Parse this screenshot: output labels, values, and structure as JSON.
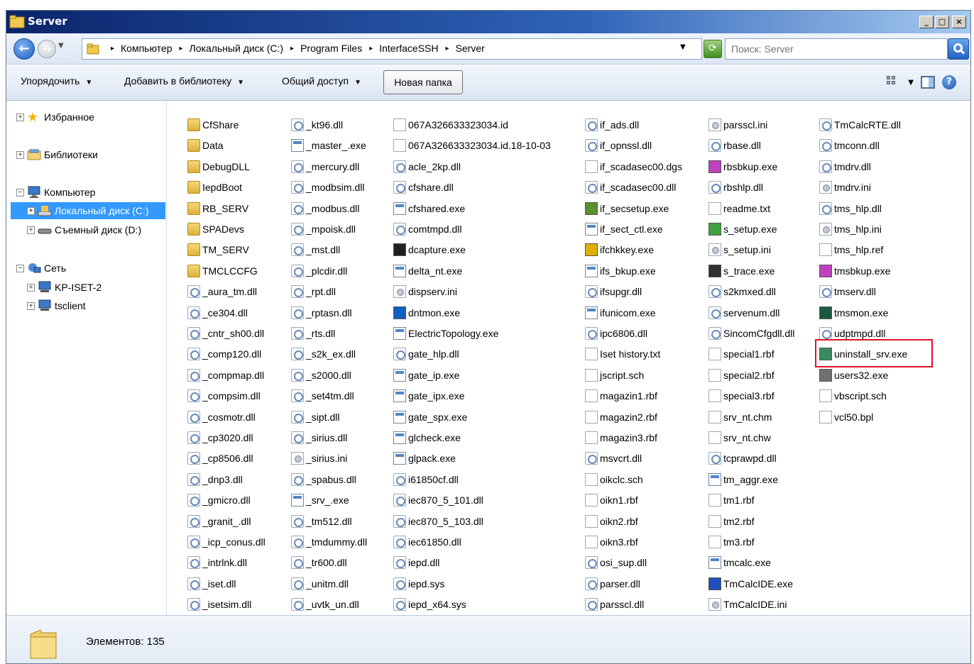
{
  "window": {
    "title": "Server"
  },
  "titlebar": {
    "minimize": "_",
    "maximize": "□",
    "close": "×"
  },
  "address": {
    "crumbs": [
      "Компьютер",
      "Локальный диск (C:)",
      "Program Files",
      "InterfaceSSH",
      "Server"
    ]
  },
  "search": {
    "placeholder": "Поиск: Server"
  },
  "toolbar": {
    "organize": "Упорядочить",
    "add_library": "Добавить в библиотеку",
    "share": "Общий доступ",
    "new_folder": "Новая папка"
  },
  "navpane": {
    "favorites": "Избранное",
    "libraries": "Библиотеки",
    "computer": "Компьютер",
    "local_disk": "Локальный диск (C:)",
    "removable_disk": "Съемный диск (D:)",
    "network": "Сеть",
    "kp_iset": "KP-ISET-2",
    "tsclient": "tsclient"
  },
  "files": [
    [
      "CfShare",
      "Data",
      "DebugDLL",
      "IepdBoot",
      "RB_SERV",
      "SPADevs",
      "TM_SERV",
      "TMCLCCFG",
      "_aura_tm.dll",
      "_ce304.dll",
      "_cntr_sh00.dll",
      "_comp120.dll",
      "_compmap.dll",
      "_compsim.dll",
      "_cosmotr.dll",
      "_cp3020.dll",
      "_cp8506.dll",
      "_dnp3.dll",
      "_gmicro.dll",
      "_granit_.dll",
      "_icp_conus.dll",
      "_intrlnk.dll",
      "_iset.dll",
      "_isetsim.dll"
    ],
    [
      "_kt96.dll",
      "_master_.exe",
      "_mercury.dll",
      "_modbsim.dll",
      "_modbus.dll",
      "_mpoisk.dll",
      "_mst.dll",
      "_plcdir.dll",
      "_rpt.dll",
      "_rptasn.dll",
      "_rts.dll",
      "_s2k_ex.dll",
      "_s2000.dll",
      "_set4tm.dll",
      "_sipt.dll",
      "_sirius.dll",
      "_sirius.ini",
      "_spabus.dll",
      "_srv_.exe",
      "_tm512.dll",
      "_tmdummy.dll",
      "_tr600.dll",
      "_unitm.dll",
      "_uvtk_un.dll"
    ],
    [
      "067A326633323034.id",
      "067A326633323034.id.18-10-03",
      "acle_2kp.dll",
      "cfshare.dll",
      "cfshared.exe",
      "comtmpd.dll",
      "dcapture.exe",
      "delta_nt.exe",
      "dispserv.ini",
      "dntmon.exe",
      "ElectricTopology.exe",
      "gate_hlp.dll",
      "gate_ip.exe",
      "gate_ipx.exe",
      "gate_spx.exe",
      "glcheck.exe",
      "glpack.exe",
      "i61850cf.dll",
      "iec870_5_101.dll",
      "iec870_5_103.dll",
      "iec61850.dll",
      "iepd.dll",
      "iepd.sys",
      "iepd_x64.sys"
    ],
    [
      "if_ads.dll",
      "if_opnssl.dll",
      "if_scadasec00.dgs",
      "if_scadasec00.dll",
      "if_secsetup.exe",
      "if_sect_ctl.exe",
      "ifchkkey.exe",
      "ifs_bkup.exe",
      "ifsupgr.dll",
      "ifunicom.exe",
      "ipc6806.dll",
      "Iset history.txt",
      "jscript.sch",
      "magazin1.rbf",
      "magazin2.rbf",
      "magazin3.rbf",
      "msvcrt.dll",
      "oikclc.sch",
      "oikn1.rbf",
      "oikn2.rbf",
      "oikn3.rbf",
      "osi_sup.dll",
      "parser.dll",
      "parsscl.dll"
    ],
    [
      "parsscl.ini",
      "rbase.dll",
      "rbsbkup.exe",
      "rbshlp.dll",
      "readme.txt",
      "s_setup.exe",
      "s_setup.ini",
      "s_trace.exe",
      "s2kmxed.dll",
      "servenum.dll",
      "SincomCfgdll.dll",
      "special1.rbf",
      "special2.rbf",
      "special3.rbf",
      "srv_nt.chm",
      "srv_nt.chw",
      "tcprawpd.dll",
      "tm_aggr.exe",
      "tm1.rbf",
      "tm2.rbf",
      "tm3.rbf",
      "tmcalc.exe",
      "TmCalcIDE.exe",
      "TmCalcIDE.ini"
    ],
    [
      "TmCalcRTE.dll",
      "tmconn.dll",
      "tmdrv.dll",
      "tmdrv.ini",
      "tms_hlp.dll",
      "tms_hlp.ini",
      "tms_hlp.ref",
      "tmsbkup.exe",
      "tmserv.dll",
      "tmsmon.exe",
      "udptmpd.dll",
      "uninstall_srv.exe",
      "users32.exe",
      "vbscript.sch",
      "vcl50.bpl"
    ]
  ],
  "highlighted_file": "uninstall_srv.exe",
  "status": {
    "count": "Элементов: 135"
  },
  "colors": {
    "selection": "#3399ff",
    "highlight": "#e0102a",
    "titlebar": "#0a246a"
  }
}
